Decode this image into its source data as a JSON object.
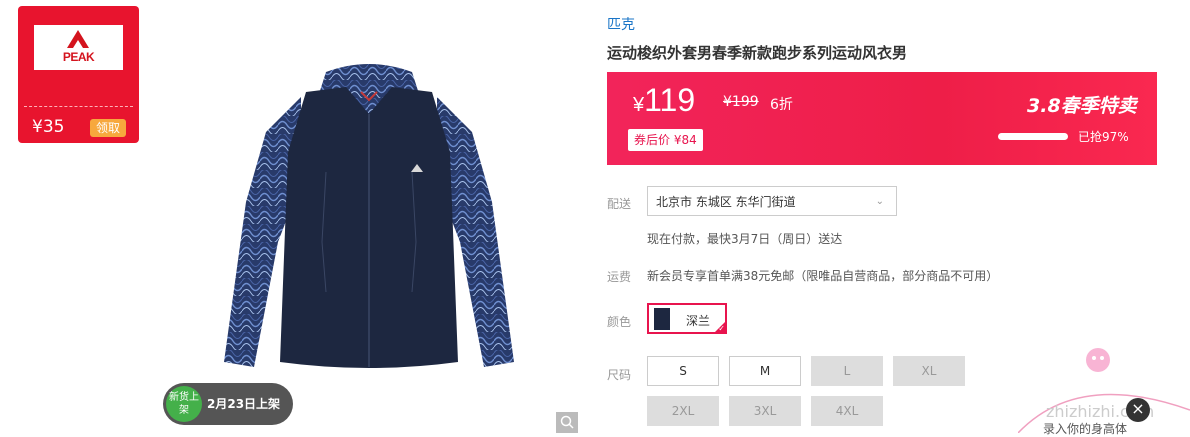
{
  "coupon": {
    "brand_logo_text": "PEAK",
    "price": "¥35",
    "get_label": "领取"
  },
  "product_image": {
    "badge_circle": "新货上架",
    "badge_text": "2月23日上架"
  },
  "info": {
    "brand": "匹克",
    "title": "运动梭织外套男春季新款跑步系列运动风衣男",
    "price_current": "119",
    "currency": "¥",
    "price_original": "¥199",
    "discount": "6折",
    "after_coupon": "券后价 ¥84",
    "promo": "3.8春季特卖",
    "sold_text": "已抢97%",
    "sold_fraction": 0.97
  },
  "delivery": {
    "label": "配送",
    "address": "北京市 东城区 东华门街道",
    "eta": "现在付款，最快3月7日（周日）送达"
  },
  "freight": {
    "label": "运费",
    "text": "新会员专享首单满38元免邮（限唯品自营商品，部分商品不可用）"
  },
  "color": {
    "label": "颜色",
    "options": [
      {
        "name": "深兰",
        "selected": true
      }
    ]
  },
  "size": {
    "label": "尺码",
    "options": [
      {
        "name": "S",
        "available": true
      },
      {
        "name": "M",
        "available": true
      },
      {
        "name": "L",
        "available": false
      },
      {
        "name": "XL",
        "available": false
      },
      {
        "name": "2XL",
        "available": false
      },
      {
        "name": "3XL",
        "available": false
      },
      {
        "name": "4XL",
        "available": false
      }
    ]
  },
  "overlay": {
    "site": "zhizhizhi.com",
    "caption": "录入你的身高体"
  },
  "colors": {
    "accent": "#e8144e",
    "brand_link": "#1a75c7",
    "coupon_red": "#e8142e"
  }
}
